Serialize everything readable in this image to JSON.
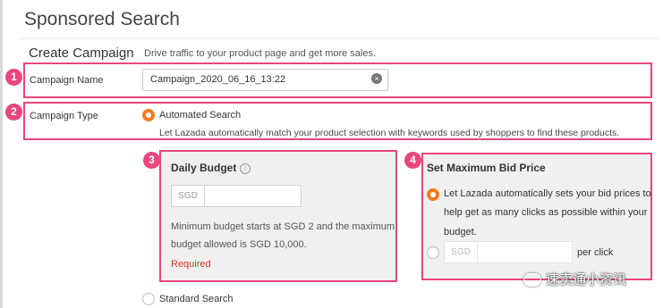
{
  "page": {
    "title": "Sponsored Search"
  },
  "create_campaign": {
    "heading": "Create Campaign",
    "description": "Drive traffic to your product page and get more sales."
  },
  "annotations": {
    "badge1": "1",
    "badge2": "2",
    "badge3": "3",
    "badge4": "4",
    "highlight_color": "#e8467c"
  },
  "campaign_name": {
    "label": "Campaign Name",
    "value": "Campaign_2020_06_16_13:22"
  },
  "campaign_type": {
    "label": "Campaign Type",
    "options": [
      {
        "label": "Automated Search",
        "selected": true,
        "description": "Let Lazada automatically match your product selection with keywords used by shoppers to find these products."
      },
      {
        "label": "Standard Search",
        "selected": false
      }
    ]
  },
  "daily_budget": {
    "title": "Daily Budget",
    "info_icon": "info-icon",
    "currency": "SGD",
    "value": "",
    "help_line1": "Minimum budget starts at SGD 2 and the maximum",
    "help_line2": "budget allowed is SGD 10,000.",
    "error": "Required"
  },
  "max_bid": {
    "title": "Set Maximum Bid Price",
    "auto_line1": "Let Lazada automatically sets your bid prices to",
    "auto_line2": "help get as many clicks as possible within your",
    "auto_line3": "budget.",
    "auto_selected": true,
    "manual_currency": "SGD",
    "manual_value": "",
    "manual_suffix": "per click"
  },
  "watermark": {
    "text": "速卖通小资讯"
  },
  "colors": {
    "accent": "#f47b20",
    "error": "#e0322e"
  }
}
